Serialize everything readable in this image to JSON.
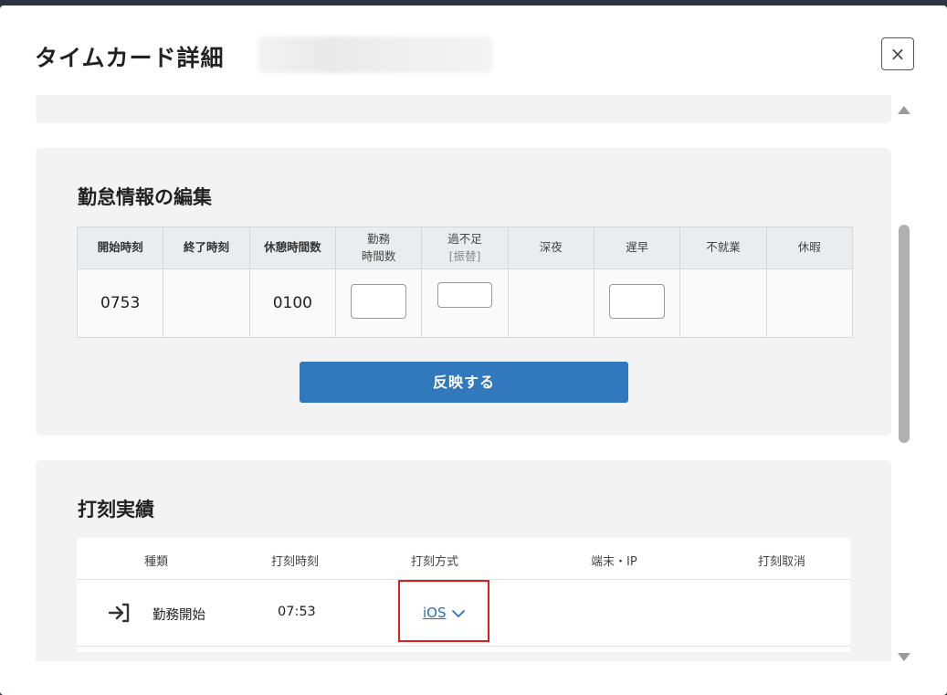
{
  "modal": {
    "title": "タイムカード詳細",
    "close_label": "×"
  },
  "edit_section": {
    "title": "勤怠情報の編集",
    "columns": [
      {
        "label": "開始時刻"
      },
      {
        "label": "終了時刻"
      },
      {
        "label": "休憩時間数"
      },
      {
        "label": "勤務",
        "label2": "時間数"
      },
      {
        "label": "過不足",
        "sub": "[振替]"
      },
      {
        "label": "深夜"
      },
      {
        "label": "遅早"
      },
      {
        "label": "不就業"
      },
      {
        "label": "休暇"
      }
    ],
    "row": {
      "start_time": "0753",
      "end_time": "",
      "break_hours": "0100",
      "work_hours_value": "",
      "excess_value": "",
      "late_early_value": ""
    },
    "apply_button": "反映する"
  },
  "record_section": {
    "title": "打刻実績",
    "headers": {
      "type": "種類",
      "time": "打刻時刻",
      "method": "打刻方式",
      "device": "端末・IP",
      "cancel": "打刻取消"
    },
    "rows": [
      {
        "icon": "clock-in-icon",
        "type": "勤務開始",
        "time": "07:53",
        "method": "iOS",
        "device": "",
        "cancel": ""
      }
    ]
  },
  "colors": {
    "primary_button": "#3178bd",
    "link": "#2a6fba",
    "highlight_border": "#e01e1e",
    "panel_bg": "#f3f3f3"
  }
}
